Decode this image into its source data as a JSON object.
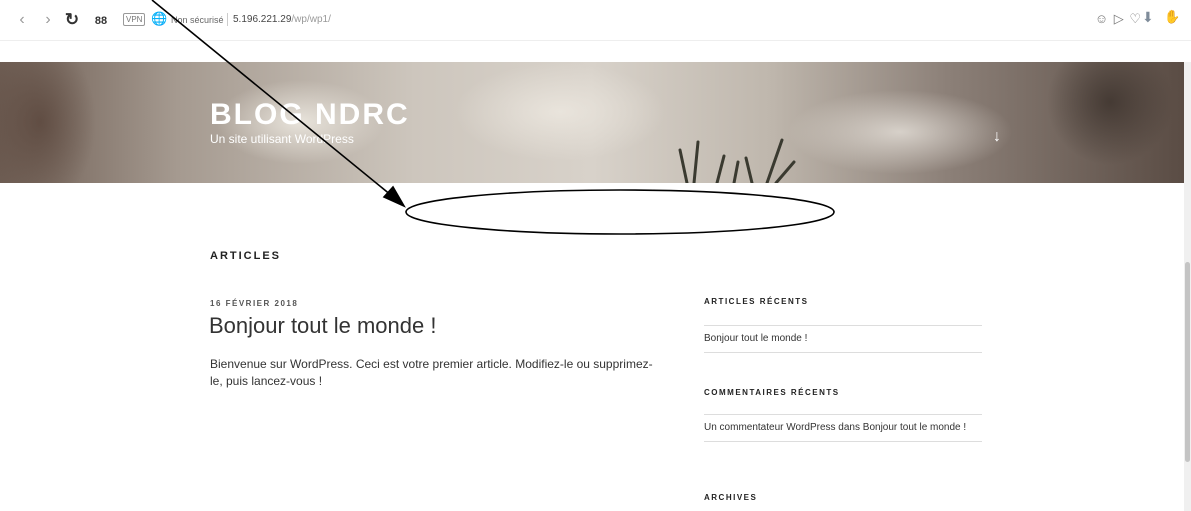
{
  "browser": {
    "vpn_label": "VPN",
    "security_label": "Non sécurisé",
    "url_host": "5.196.221.29",
    "url_path": "/wp/wp1/",
    "addr_icons": "☺ ▷ ♡"
  },
  "header": {
    "site_title": "BLOG NDRC",
    "site_description": "Un site utilisant WordPress"
  },
  "content": {
    "section_title": "ARTICLES",
    "post": {
      "date": "16 FÉVRIER 2018",
      "title": "Bonjour tout le monde !",
      "excerpt": "Bienvenue sur WordPress. Ceci est votre premier article. Modifiez-le ou supprimez-le, puis lancez-vous !"
    }
  },
  "sidebar": {
    "recent_posts_title": "ARTICLES RÉCENTS",
    "recent_posts": [
      "Bonjour tout le monde !"
    ],
    "recent_comments_title": "COMMENTAIRES RÉCENTS",
    "recent_comments": [
      "Un commentateur WordPress dans Bonjour tout le monde !"
    ],
    "archives_title": "ARCHIVES"
  },
  "colors": {
    "header_text": "#ffffff",
    "body_text": "#333333",
    "divider": "#dddddd"
  }
}
